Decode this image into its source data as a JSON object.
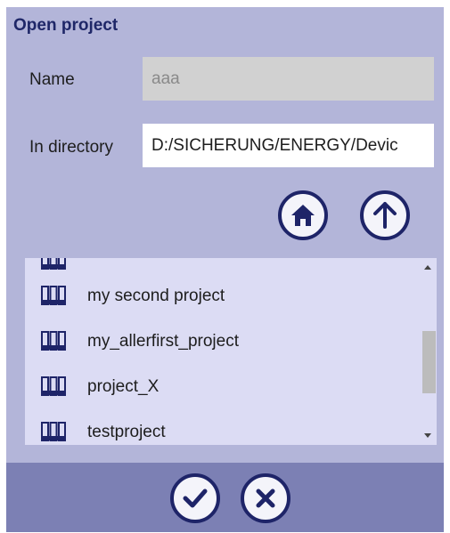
{
  "dialog": {
    "title": "Open project",
    "name_label": "Name",
    "name_value": "aaa",
    "directory_label": "In directory",
    "directory_value": "D:/SICHERUNG/ENERGY/Devic"
  },
  "toolbar": {
    "home_icon": "home-icon",
    "up_icon": "arrow-up-icon"
  },
  "projects": {
    "items": [
      {
        "label": "my second project"
      },
      {
        "label": "my_allerfirst_project"
      },
      {
        "label": "project_X"
      },
      {
        "label": "testproject"
      }
    ],
    "item_icon": "binders-icon"
  },
  "footer": {
    "ok_icon": "checkmark-icon",
    "cancel_icon": "close-icon"
  },
  "colors": {
    "dialog_bg": "#b3b5d9",
    "list_bg": "#dcdcf4",
    "footer_bg": "#7c80b4",
    "accent": "#1e2468"
  }
}
